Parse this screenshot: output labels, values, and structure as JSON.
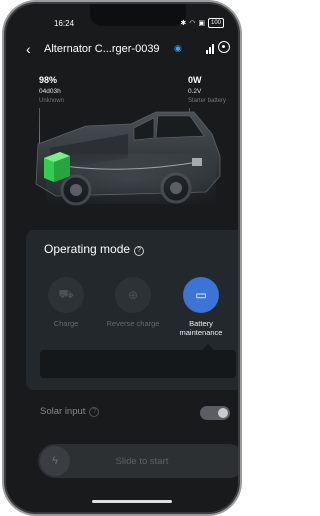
{
  "status_bar": {
    "time": "16:24",
    "icons": [
      "bluetooth-icon",
      "wifi-icon",
      "sim-icon"
    ],
    "battery": "100"
  },
  "header": {
    "title": "Alternator C...rger-0039"
  },
  "stats": {
    "left": {
      "value": "98%",
      "time": "04d03h",
      "label": "Unknown"
    },
    "right": {
      "value": "0W",
      "voltage": "0.2V",
      "label": "Starter battery"
    }
  },
  "operating_mode": {
    "title": "Operating mode",
    "modes": [
      {
        "label": "Charge",
        "active": false
      },
      {
        "label": "Reverse charge",
        "active": false
      },
      {
        "label": "Battery maintenance",
        "active": true
      }
    ]
  },
  "solar": {
    "label": "Solar input",
    "enabled": true
  },
  "slider": {
    "label": "Slide to start"
  },
  "colors": {
    "accent": "#3b74d4",
    "battery_green": "#2fd24a",
    "background": "#181a1c",
    "panel": "#23282c"
  }
}
